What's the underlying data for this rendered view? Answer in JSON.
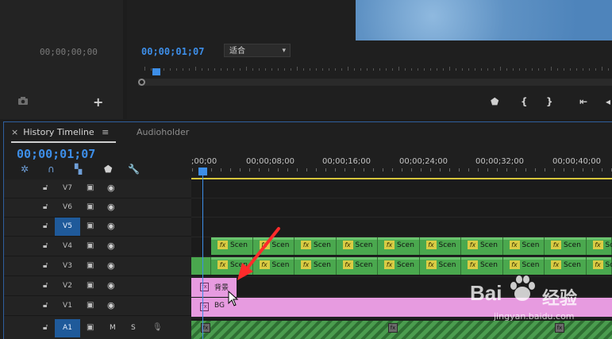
{
  "source_monitor": {
    "timecode": "00;00;00;00",
    "icons": [
      "camera-icon",
      "plus-icon"
    ]
  },
  "program_monitor": {
    "timecode": "00;00;01;07",
    "fit_select": {
      "value": "适合"
    },
    "controls": [
      "marker-icon",
      "in-bracket-icon",
      "out-bracket-icon",
      "go-to-in-icon"
    ]
  },
  "timeline": {
    "tab_active": "History Timeline",
    "tab_menu": "≡",
    "tab_close": "×",
    "tab_inactive": "Audioholder",
    "timecode": "00;00;01;07",
    "tools": [
      "snap-icon",
      "magnet-icon",
      "linked-select-icon",
      "add-marker-icon",
      "wrench-icon"
    ],
    "ruler_labels": [
      ";00;00",
      "00;00;08;00",
      "00;00;16;00",
      "00;00;24;00",
      "00;00;32;00",
      "00;00;40;00"
    ],
    "tracks": [
      {
        "name": "V7",
        "active": false
      },
      {
        "name": "V6",
        "active": false
      },
      {
        "name": "V5",
        "active": true
      },
      {
        "name": "V4",
        "active": false
      },
      {
        "name": "V3",
        "active": false
      },
      {
        "name": "V2",
        "active": false
      },
      {
        "name": "V1",
        "active": false
      },
      {
        "name": "A1",
        "active": true,
        "audio": true,
        "mute": "M",
        "solo": "S"
      }
    ],
    "fx_clip_label": "Scen",
    "fx_badge": "fx",
    "v2_clip_label": "背景",
    "v1_clip_label": "BG"
  },
  "watermark": {
    "brand": "Bai",
    "brand_tail": "经验",
    "url": "jingyan.baidu.com"
  },
  "colors": {
    "accent": "#3d8ee8",
    "fx_clip": "#4aa84e",
    "pink_clip": "#e79be0",
    "work_area": "#d6c53c"
  }
}
